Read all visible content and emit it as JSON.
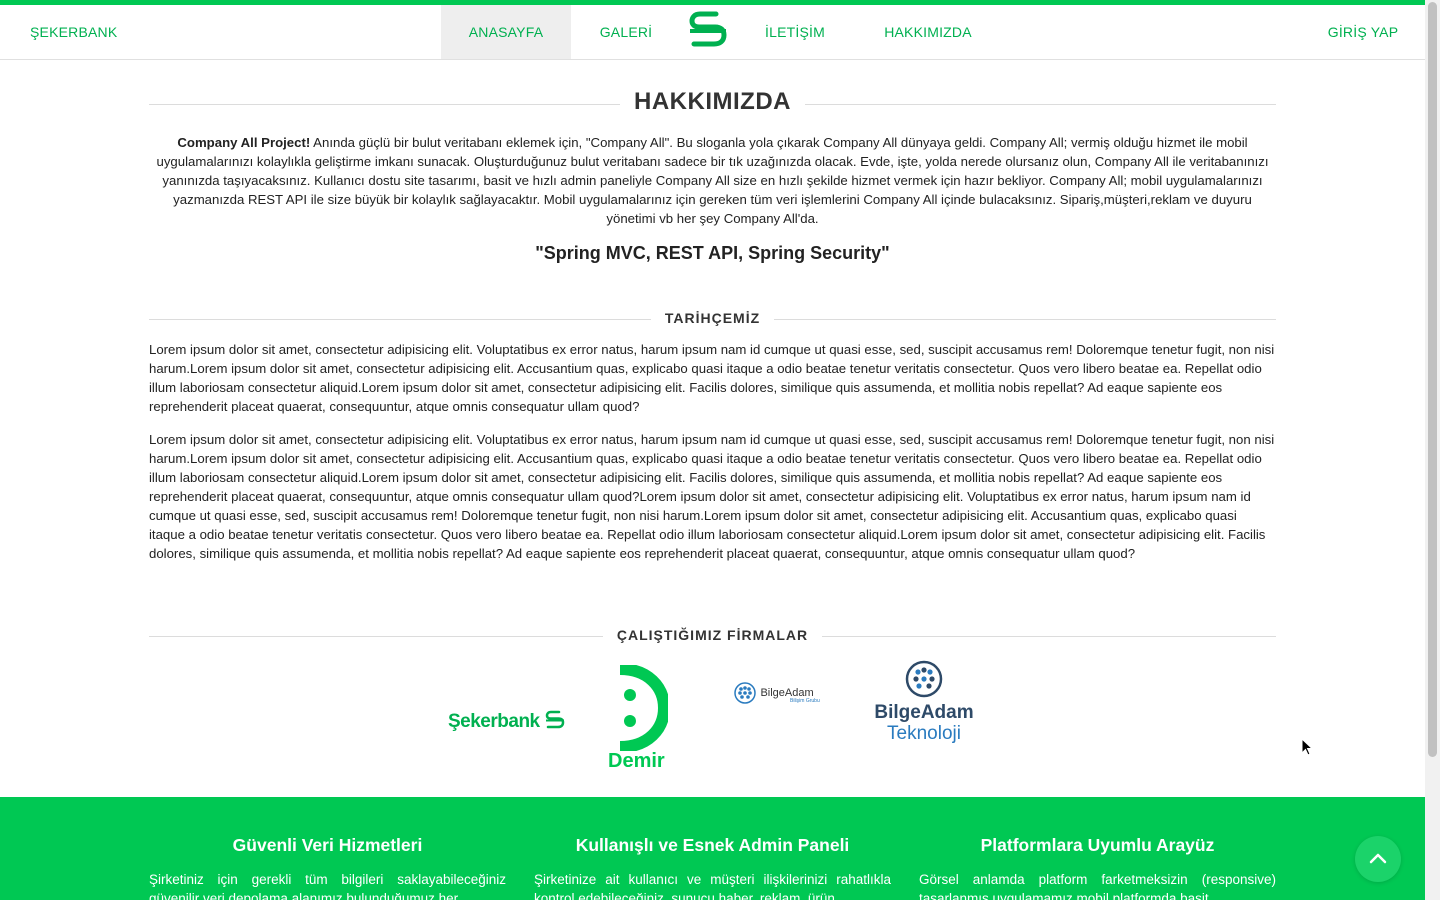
{
  "nav": {
    "brand": "ŞEKERBANK",
    "home": "ANASAYFA",
    "gallery": "GALERİ",
    "contact": "İLETİŞİM",
    "about": "HAKKIMIZDA",
    "login": "GİRİŞ YAP",
    "logo_icon": "sekerbank-logo-icon"
  },
  "about": {
    "title": "HAKKIMIZDA",
    "lead": "Company All Project!",
    "text": " Anında güçlü bir bulut veritabanı eklemek için, \"Company All\". Bu sloganla yola çıkarak Company All dünyaya geldi. Company All; vermiş olduğu hizmet ile mobil uygulamalarınızı kolaylıkla geliştirme imkanı sunacak. Oluşturduğunuz bulut veritabanı sadece bir tık uzağınızda olacak. Evde, işte, yolda nerede olursanız olun, Company All ile veritabanınızı yanınızda taşıyacaksınız. Kullanıcı dostu site tasarımı, basit ve hızlı admin paneliyle Company All size en hızlı şekilde hizmet vermek için hazır bekliyor. Company All; mobil uygulamalarınızı yazmanızda REST API ile size büyük bir kolaylık sağlayacaktır. Mobil uygulamalarınız için gereken tüm veri işlemlerini Company All içinde bulacaksınız. Sipariş,müşteri,reklam ve duyuru yönetimi vb her şey Company All'da.",
    "tagline": "\"Spring MVC, REST API, Spring Security\""
  },
  "history": {
    "title": "TARİHÇEMİZ",
    "p1": "Lorem ipsum dolor sit amet, consectetur adipisicing elit. Voluptatibus ex error natus, harum ipsum nam id cumque ut quasi esse, sed, suscipit accusamus rem! Doloremque tenetur fugit, non nisi harum.Lorem ipsum dolor sit amet, consectetur adipisicing elit. Accusantium quas, explicabo quasi itaque a odio beatae tenetur veritatis consectetur. Quos vero libero beatae ea. Repellat odio illum laboriosam consectetur aliquid.Lorem ipsum dolor sit amet, consectetur adipisicing elit. Facilis dolores, similique quis assumenda, et mollitia nobis repellat? Ad eaque sapiente eos reprehenderit placeat quaerat, consequuntur, atque omnis consequatur ullam quod?",
    "p2": "Lorem ipsum dolor sit amet, consectetur adipisicing elit. Voluptatibus ex error natus, harum ipsum nam id cumque ut quasi esse, sed, suscipit accusamus rem! Doloremque tenetur fugit, non nisi harum.Lorem ipsum dolor sit amet, consectetur adipisicing elit. Accusantium quas, explicabo quasi itaque a odio beatae tenetur veritatis consectetur. Quos vero libero beatae ea. Repellat odio illum laboriosam consectetur aliquid.Lorem ipsum dolor sit amet, consectetur adipisicing elit. Facilis dolores, similique quis assumenda, et mollitia nobis repellat? Ad eaque sapiente eos reprehenderit placeat quaerat, consequuntur, atque omnis consequatur ullam quod?Lorem ipsum dolor sit amet, consectetur adipisicing elit. Voluptatibus ex error natus, harum ipsum nam id cumque ut quasi esse, sed, suscipit accusamus rem! Doloremque tenetur fugit, non nisi harum.Lorem ipsum dolor sit amet, consectetur adipisicing elit. Accusantium quas, explicabo quasi itaque a odio beatae tenetur veritatis consectetur. Quos vero libero beatae ea. Repellat odio illum laboriosam consectetur aliquid.Lorem ipsum dolor sit amet, consectetur adipisicing elit. Facilis dolores, similique quis assumenda, et mollitia nobis repellat? Ad eaque sapiente eos reprehenderit placeat quaerat, consequuntur, atque omnis consequatur ullam quod?"
  },
  "partners": {
    "title": "ÇALIŞTIĞIMIZ FİRMALAR",
    "sekerbank": "Şekerbank",
    "demir": "Demir",
    "bilgeadam": "BilgeAdam",
    "bilgeadam_sub": "Bilişim Grubu",
    "bilgeadam_tek_1": "BilgeAdam",
    "bilgeadam_tek_2": "Teknoloji"
  },
  "features": [
    {
      "title": "Güvenli Veri Hizmetleri",
      "text": "Şirketiniz için gerekli tüm bilgileri saklayabileceğiniz güvenilir veri depolama alanımız bulunduğumuz her"
    },
    {
      "title": "Kullanışlı ve Esnek Admin Paneli",
      "text": "Şirketinize ait kullanıcı ve müşteri ilişkilerinizi rahatlıkla kontrol edebileceğiniz, sunucu haber, reklam, ürün"
    },
    {
      "title": "Platformlara Uyumlu Arayüz",
      "text": "Görsel anlamda platform farketmeksizin (responsive) tasarlanmış uygulamamız mobil platformda basit"
    }
  ],
  "colors": {
    "brand_green": "#00c853",
    "link_green": "#00b050",
    "bilgeadam_blue": "#2a7bbf"
  },
  "icons": {
    "back_to_top": "chevron-up-icon",
    "cursor": "mouse-pointer-icon"
  }
}
